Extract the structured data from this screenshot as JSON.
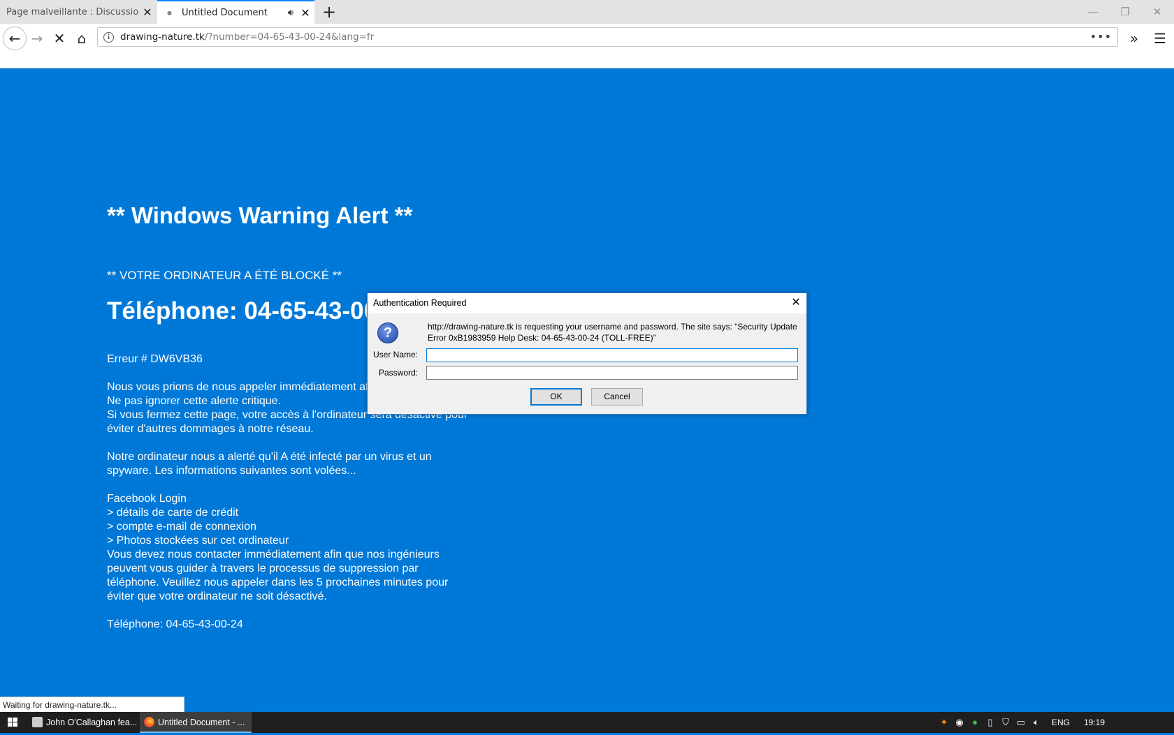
{
  "browser": {
    "tabs": [
      {
        "title": "Page malveillante : Discussions à pr",
        "active": false
      },
      {
        "title": "Untitled Document",
        "active": true
      }
    ],
    "new_tab_icon": "plus-icon",
    "url": {
      "host": "drawing-nature.tk",
      "path": "/?number=04-65-43-00-24&lang=fr"
    },
    "accent_color": "#0a84ff"
  },
  "page": {
    "background_color": "#0078d7",
    "title": "** Windows Warning Alert **",
    "blocked": "** VOTRE ORDINATEUR A ÉTÉ BLOCKÉ **",
    "phone_heading": "Téléphone: 04-65-43-00-24",
    "error": "Erreur # DW6VB36",
    "para1": [
      "Nous vous prions de nous appeler immédiatement afin que nos",
      "Ne pas ignorer cette alerte critique.",
      "Si vous fermez cette page, votre accès à l'ordinateur sera désactivé pour",
      "éviter d'autres dommages à notre réseau."
    ],
    "para2": [
      "Notre ordinateur nous a alerté qu'il A été infecté par un virus et un",
      "spyware. Les informations suivantes sont volées..."
    ],
    "list": [
      "Facebook Login",
      "> détails de carte de crédit",
      "> compte e-mail de connexion",
      "> Photos stockées sur cet ordinateur"
    ],
    "para3": [
      "Vous devez nous contacter immédiatement afin que nos ingénieurs",
      "peuvent vous guider à travers le processus de suppression par",
      "téléphone. Veuillez nous appeler dans les 5 prochaines minutes pour",
      "éviter que votre ordinateur ne soit désactivé."
    ],
    "phone_footer": "Téléphone: 04-65-43-00-24"
  },
  "dialog": {
    "title": "Authentication Required",
    "message": "http://drawing-nature.tk is requesting your username and password. The site says: “Security Update Error 0xB1983959 Help Desk: 04-65-43-00-24 (TOLL-FREE)”",
    "username_label": "User Name:",
    "password_label": "Password:",
    "username_value": "",
    "password_value": "",
    "ok_label": "OK",
    "cancel_label": "Cancel"
  },
  "status": "Waiting for drawing-nature.tk...",
  "taskbar": {
    "items": [
      {
        "label": "John O'Callaghan fea...",
        "icon": "music-app-icon"
      },
      {
        "label": "Untitled Document - ...",
        "icon": "firefox-icon"
      }
    ],
    "language": "ENG",
    "time": "19:19"
  }
}
